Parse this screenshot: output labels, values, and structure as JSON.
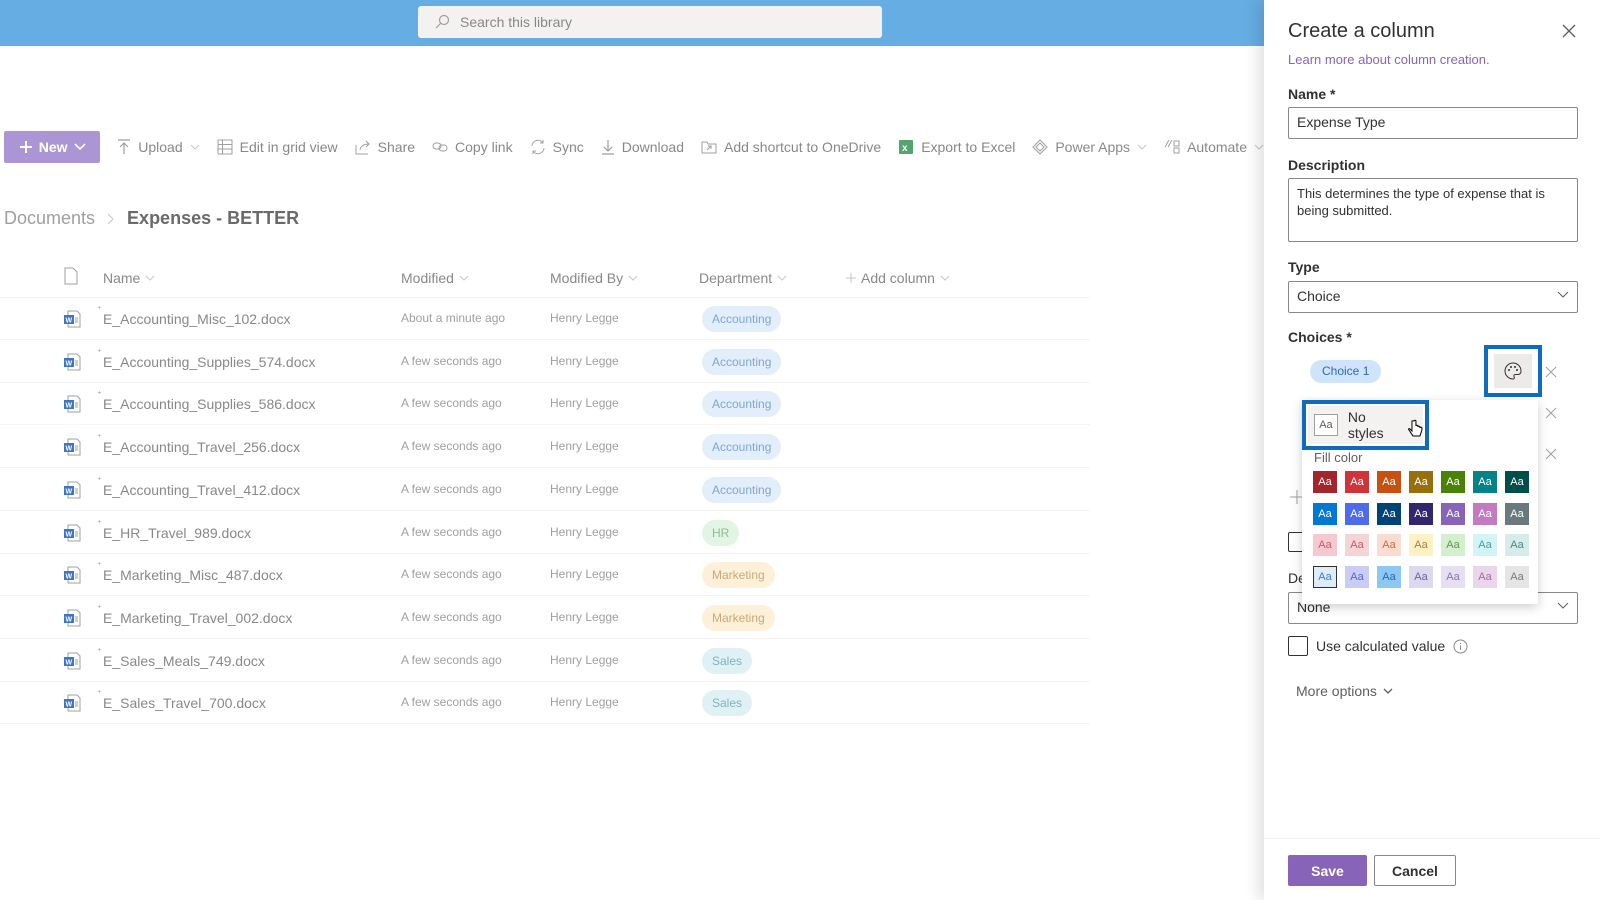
{
  "search": {
    "placeholder": "Search this library",
    "icon": "search-icon"
  },
  "commandbar": {
    "new_label": "New",
    "items": [
      {
        "label": "Upload",
        "icon": "upload-icon",
        "has_chevron": true
      },
      {
        "label": "Edit in grid view",
        "icon": "grid-icon",
        "has_chevron": false
      },
      {
        "label": "Share",
        "icon": "share-icon",
        "has_chevron": false
      },
      {
        "label": "Copy link",
        "icon": "link-icon",
        "has_chevron": false
      },
      {
        "label": "Sync",
        "icon": "sync-icon",
        "has_chevron": false
      },
      {
        "label": "Download",
        "icon": "download-icon",
        "has_chevron": false
      },
      {
        "label": "Add shortcut to OneDrive",
        "icon": "shortcut-icon",
        "has_chevron": false
      },
      {
        "label": "Export to Excel",
        "icon": "excel-icon",
        "has_chevron": false
      },
      {
        "label": "Power Apps",
        "icon": "powerapps-icon",
        "has_chevron": true
      },
      {
        "label": "Automate",
        "icon": "automate-icon",
        "has_chevron": true
      }
    ]
  },
  "breadcrumb": {
    "parent": "Documents",
    "current": "Expenses - BETTER"
  },
  "list": {
    "columns": {
      "name": "Name",
      "modified": "Modified",
      "modified_by": "Modified By",
      "department": "Department",
      "add_column": "Add column"
    },
    "rows": [
      {
        "name": "E_Accounting_Misc_102.docx",
        "modified": "About a minute ago",
        "modified_by": "Henry Legge",
        "department": "Accounting"
      },
      {
        "name": "E_Accounting_Supplies_574.docx",
        "modified": "A few seconds ago",
        "modified_by": "Henry Legge",
        "department": "Accounting"
      },
      {
        "name": "E_Accounting_Supplies_586.docx",
        "modified": "A few seconds ago",
        "modified_by": "Henry Legge",
        "department": "Accounting"
      },
      {
        "name": "E_Accounting_Travel_256.docx",
        "modified": "A few seconds ago",
        "modified_by": "Henry Legge",
        "department": "Accounting"
      },
      {
        "name": "E_Accounting_Travel_412.docx",
        "modified": "A few seconds ago",
        "modified_by": "Henry Legge",
        "department": "Accounting"
      },
      {
        "name": "E_HR_Travel_989.docx",
        "modified": "A few seconds ago",
        "modified_by": "Henry Legge",
        "department": "HR"
      },
      {
        "name": "E_Marketing_Misc_487.docx",
        "modified": "A few seconds ago",
        "modified_by": "Henry Legge",
        "department": "Marketing"
      },
      {
        "name": "E_Marketing_Travel_002.docx",
        "modified": "A few seconds ago",
        "modified_by": "Henry Legge",
        "department": "Marketing"
      },
      {
        "name": "E_Sales_Meals_749.docx",
        "modified": "A few seconds ago",
        "modified_by": "Henry Legge",
        "department": "Sales"
      },
      {
        "name": "E_Sales_Travel_700.docx",
        "modified": "A few seconds ago",
        "modified_by": "Henry Legge",
        "department": "Sales"
      }
    ],
    "department_colors": {
      "Accounting": {
        "bg": "#e3eefb",
        "fg": "#7ea6d6"
      },
      "HR": {
        "bg": "#e2f4e3",
        "fg": "#8cbf92"
      },
      "Marketing": {
        "bg": "#fdf0d9",
        "fg": "#c9a977"
      },
      "Sales": {
        "bg": "#dff1f5",
        "fg": "#7fb2be"
      }
    }
  },
  "panel": {
    "title": "Create a column",
    "learn_more": "Learn more about column creation.",
    "name_label": "Name *",
    "name_value": "Expense Type",
    "description_label": "Description",
    "description_value": "This determines the type of expense that is being submitted.",
    "type_label": "Type",
    "type_value": "Choice",
    "choices_label": "Choices *",
    "choice_1": "Choice 1",
    "default_label_partial": "De",
    "default_value": "None",
    "use_calculated_label": "Use calculated value",
    "more_options": "More options",
    "save": "Save",
    "cancel": "Cancel"
  },
  "style_popup": {
    "no_styles_label": "No styles",
    "aa": "Aa",
    "fill_color_label": "Fill color",
    "swatches": [
      [
        {
          "bg": "#a4262c",
          "fg": "#fff"
        },
        {
          "bg": "#d13438",
          "fg": "#fff"
        },
        {
          "bg": "#ca5010",
          "fg": "#fff"
        },
        {
          "bg": "#986f0b",
          "fg": "#fff"
        },
        {
          "bg": "#498205",
          "fg": "#fff"
        },
        {
          "bg": "#038387",
          "fg": "#fff"
        },
        {
          "bg": "#004e49",
          "fg": "#fff"
        }
      ],
      [
        {
          "bg": "#0078d4",
          "fg": "#fff"
        },
        {
          "bg": "#4f6bed",
          "fg": "#fff"
        },
        {
          "bg": "#004377",
          "fg": "#fff"
        },
        {
          "bg": "#32276e",
          "fg": "#fff"
        },
        {
          "bg": "#8764b8",
          "fg": "#fff"
        },
        {
          "bg": "#c27bc0",
          "fg": "#fff"
        },
        {
          "bg": "#69797e",
          "fg": "#fff"
        }
      ],
      [
        {
          "bg": "#f8c8d0",
          "fg": "#b6606c"
        },
        {
          "bg": "#f6d3d6",
          "fg": "#b6606c"
        },
        {
          "bg": "#fcdcd0",
          "fg": "#c07050"
        },
        {
          "bg": "#fff1c4",
          "fg": "#a08040"
        },
        {
          "bg": "#d4efce",
          "fg": "#5a9a50"
        },
        {
          "bg": "#d2f4f6",
          "fg": "#4a9aa0"
        },
        {
          "bg": "#d5ecea",
          "fg": "#4a8a86"
        }
      ],
      [
        {
          "bg": "#deecf9",
          "fg": "#3a7ac0",
          "selected": true
        },
        {
          "bg": "#c9cdf5",
          "fg": "#5a66c0"
        },
        {
          "bg": "#8cc8f5",
          "fg": "#2a6aa8"
        },
        {
          "bg": "#dcd9ef",
          "fg": "#6a64a0"
        },
        {
          "bg": "#e6def3",
          "fg": "#8a74b0"
        },
        {
          "bg": "#ebd5ea",
          "fg": "#a06ca0"
        },
        {
          "bg": "#e5e5e5",
          "fg": "#7a7a7a"
        }
      ]
    ]
  }
}
